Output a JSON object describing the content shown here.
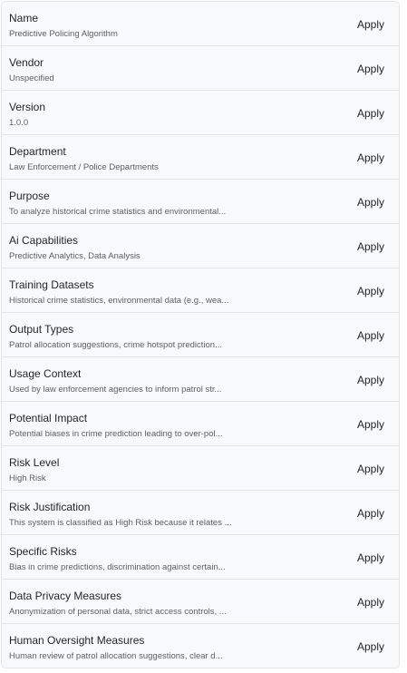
{
  "fields": [
    {
      "label": "Name",
      "value": "Predictive Policing Algorithm",
      "action": "Apply"
    },
    {
      "label": "Vendor",
      "value": "Unspecified",
      "action": "Apply"
    },
    {
      "label": "Version",
      "value": "1.0.0",
      "action": "Apply"
    },
    {
      "label": "Department",
      "value": "Law Enforcement / Police Departments",
      "action": "Apply"
    },
    {
      "label": "Purpose",
      "value": "To analyze historical crime statistics and environmental...",
      "action": "Apply"
    },
    {
      "label": "Ai Capabilities",
      "value": "Predictive Analytics, Data Analysis",
      "action": "Apply"
    },
    {
      "label": "Training Datasets",
      "value": "Historical crime statistics, environmental data (e.g., wea...",
      "action": "Apply"
    },
    {
      "label": "Output Types",
      "value": "Patrol allocation suggestions, crime hotspot prediction...",
      "action": "Apply"
    },
    {
      "label": "Usage Context",
      "value": "Used by law enforcement agencies to inform patrol str...",
      "action": "Apply"
    },
    {
      "label": "Potential Impact",
      "value": "Potential biases in crime prediction leading to over-pol...",
      "action": "Apply"
    },
    {
      "label": "Risk Level",
      "value": "High Risk",
      "action": "Apply"
    },
    {
      "label": "Risk Justification",
      "value": "This system is classified as High Risk because it relates ...",
      "action": "Apply"
    },
    {
      "label": "Specific Risks",
      "value": "Bias in crime predictions, discrimination against certain...",
      "action": "Apply"
    },
    {
      "label": "Data Privacy Measures",
      "value": "Anonymization of personal data, strict access controls, ...",
      "action": "Apply"
    },
    {
      "label": "Human Oversight Measures",
      "value": "Human review of patrol allocation suggestions, clear d...",
      "action": "Apply"
    }
  ]
}
